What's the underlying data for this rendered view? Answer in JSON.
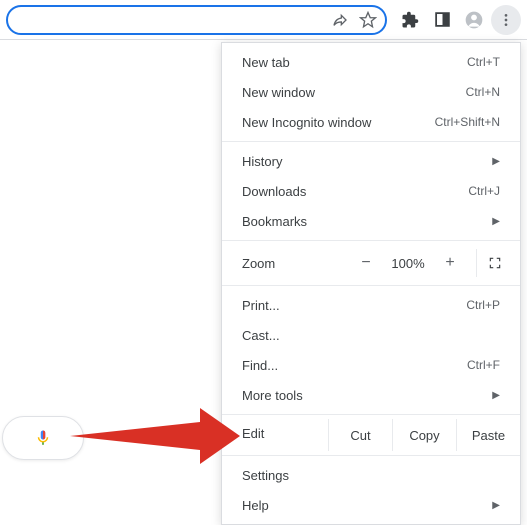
{
  "toolbar": {
    "share_icon": "share-icon",
    "star_icon": "star-icon",
    "extensions_icon": "extensions-icon",
    "panel_icon": "panel-icon",
    "profile_icon": "profile-icon",
    "menu_icon": "kebab-menu-icon"
  },
  "mic_icon": "microphone-icon",
  "menu": {
    "new_tab": {
      "label": "New tab",
      "shortcut": "Ctrl+T"
    },
    "new_window": {
      "label": "New window",
      "shortcut": "Ctrl+N"
    },
    "new_incognito": {
      "label": "New Incognito window",
      "shortcut": "Ctrl+Shift+N"
    },
    "history": {
      "label": "History"
    },
    "downloads": {
      "label": "Downloads",
      "shortcut": "Ctrl+J"
    },
    "bookmarks": {
      "label": "Bookmarks"
    },
    "zoom": {
      "label": "Zoom",
      "minus": "−",
      "value": "100%",
      "plus": "+"
    },
    "print": {
      "label": "Print...",
      "shortcut": "Ctrl+P"
    },
    "cast": {
      "label": "Cast..."
    },
    "find": {
      "label": "Find...",
      "shortcut": "Ctrl+F"
    },
    "more_tools": {
      "label": "More tools"
    },
    "edit": {
      "label": "Edit",
      "cut": "Cut",
      "copy": "Copy",
      "paste": "Paste"
    },
    "settings": {
      "label": "Settings"
    },
    "help": {
      "label": "Help"
    }
  }
}
